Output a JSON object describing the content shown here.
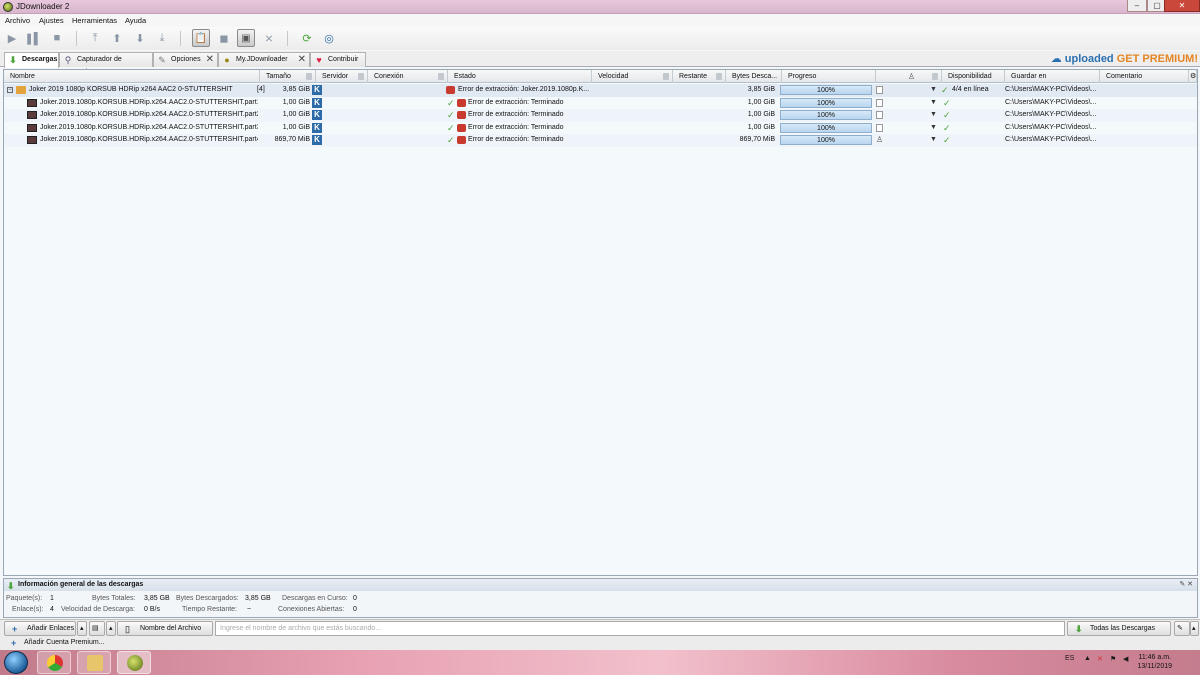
{
  "window": {
    "title": "JDownloader 2"
  },
  "menu": [
    "Archivo",
    "Ajustes",
    "Herramientas",
    "Ayuda"
  ],
  "tabs": [
    {
      "label": "Descargas",
      "closable": false,
      "active": true
    },
    {
      "label": "Capturador de Enlaces",
      "closable": false,
      "active": false
    },
    {
      "label": "Opciones",
      "closable": true,
      "active": false
    },
    {
      "label": "My.JDownloader",
      "closable": true,
      "active": false
    },
    {
      "label": "Contribuir",
      "closable": false,
      "active": false
    }
  ],
  "promo": {
    "brand": "uploaded",
    "cta": "GET PREMIUM!"
  },
  "columns": {
    "nombre": "Nombre",
    "tamano": "Tamaño",
    "servidor": "Servidor",
    "conexion": "Conexión",
    "estado": "Estado",
    "velocidad": "Velocidad",
    "restante": "Restante",
    "bytes": "Bytes Desca...",
    "progreso": "Progreso",
    "disponibilidad": "Disponibilidad",
    "guardar": "Guardar en",
    "comentario": "Comentario"
  },
  "package": {
    "expander": "[-]",
    "name": "Joker 2019 1080p KORSUB HDRip x264 AAC2 0-STUTTERSHIT",
    "count": "[4]",
    "size": "3,85 GiB",
    "host": "K",
    "status": "Error de extracción: Joker.2019.1080p.K...",
    "bytes": "3,85 GiB",
    "progress_label": "100%",
    "progress_fraction": 1.0,
    "availability": "4/4 en línea",
    "save_to": "C:\\Users\\MAKY-PC\\Videos\\..."
  },
  "files": [
    {
      "name": "Joker.2019.1080p.KORSUB.HDRip.x264.AAC2.0-STUTTERSHIT.part1.ra",
      "size": "1,00 GiB",
      "host": "K",
      "status": "Error de extracción: Terminado",
      "bytes": "1,00 GiB",
      "progress_label": "100%",
      "progress_fraction": 1.0,
      "save_to": "C:\\Users\\MAKY-PC\\Videos\\..."
    },
    {
      "name": "Joker.2019.1080p.KORSUB.HDRip.x264.AAC2.0-STUTTERSHIT.part2.ra",
      "size": "1,00 GiB",
      "host": "K",
      "status": "Error de extracción: Terminado",
      "bytes": "1,00 GiB",
      "progress_label": "100%",
      "progress_fraction": 1.0,
      "save_to": "C:\\Users\\MAKY-PC\\Videos\\..."
    },
    {
      "name": "Joker.2019.1080p.KORSUB.HDRip.x264.AAC2.0-STUTTERSHIT.part3.ra",
      "size": "1,00 GiB",
      "host": "K",
      "status": "Error de extracción: Terminado",
      "bytes": "1,00 GiB",
      "progress_label": "100%",
      "progress_fraction": 1.0,
      "save_to": "C:\\Users\\MAKY-PC\\Videos\\..."
    },
    {
      "name": "Joker.2019.1080p.KORSUB.HDRip.x264.AAC2.0-STUTTERSHIT.part4.ra",
      "size": "869,70 MiB",
      "host": "K",
      "status": "Error de extracción: Terminado",
      "bytes": "869,70 MiB",
      "progress_label": "100%",
      "progress_fraction": 1.0,
      "save_to": "C:\\Users\\MAKY-PC\\Videos\\..."
    }
  ],
  "summary": {
    "title": "Información general de las descargas",
    "paquetes_label": "Paquete(s):",
    "paquetes": "1",
    "enlaces_label": "Enlace(s):",
    "enlaces": "4",
    "bytes_totales_label": "Bytes Totales:",
    "bytes_totales": "3,85 GB",
    "velocidad_label": "Velocidad de Descarga:",
    "velocidad": "0 B/s",
    "bytes_descargados_label": "Bytes Descargados:",
    "bytes_descargados": "3,85 GB",
    "tiempo_label": "Tiempo Restante:",
    "tiempo": "~",
    "en_curso_label": "Descargas en Curso:",
    "en_curso": "0",
    "conexiones_label": "Conexiones Abiertas:",
    "conexiones": "0"
  },
  "bottom": {
    "add_links": "Añadir Enlaces",
    "filter_label": "Nombre del Archivo",
    "search_placeholder": "Ingrese el nombre de archivo que estás buscando...",
    "all_downloads": "Todas las Descargas",
    "add_premium": "Añadir Cuenta Premium..."
  },
  "taskbar": {
    "lang": "ES",
    "time": "11:46 a.m.",
    "date": "13/11/2019"
  },
  "colors": {
    "accent": "#2d6aa8",
    "progress": "#b8d5ef",
    "error": "#c83a2e",
    "ok": "#4ea33a"
  }
}
